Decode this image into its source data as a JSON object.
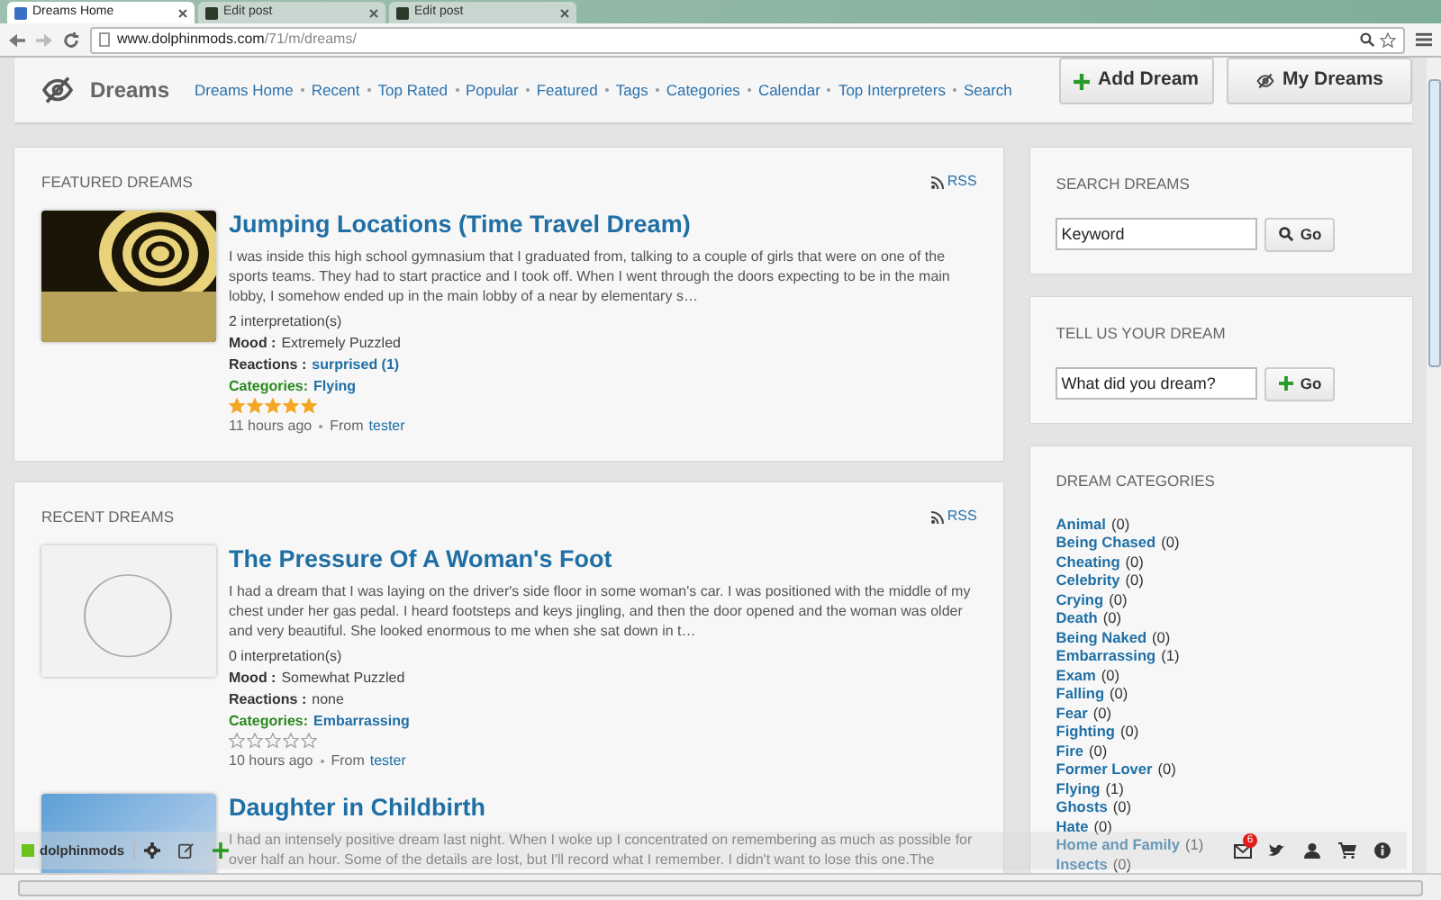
{
  "browser": {
    "tabs": [
      {
        "label": "Dreams Home",
        "selected": true
      },
      {
        "label": "Edit post",
        "selected": false
      },
      {
        "label": "Edit post",
        "selected": false
      }
    ],
    "address": {
      "host": "www.dolphinmods.com",
      "path": "/71/m/dreams/"
    }
  },
  "header": {
    "title": "Dreams",
    "nav": [
      "Dreams Home",
      "Recent",
      "Top Rated",
      "Popular",
      "Featured",
      "Tags",
      "Categories",
      "Calendar",
      "Top Interpreters",
      "Search"
    ],
    "buttons": [
      {
        "kind": "add",
        "label": "Add Dream"
      },
      {
        "kind": "mine",
        "label": "My Dreams"
      }
    ]
  },
  "sections": [
    {
      "title": "FEATURED DREAMS",
      "rss": "RSS",
      "dreams": [
        {
          "title": "Jumping Locations (Time Travel Dream)",
          "kind": "tunnel",
          "description": "I was inside this high school gymnasium that I graduated from, talking to a couple of girls that were on one of the sports teams. They had to start practice and I took off. When I went through the doors expecting to be in the main lobby, I somehow ended up in the main lobby of a near by elementary s…",
          "interpretations": "2 interpretation(s)",
          "mood_label": "Mood :",
          "mood": "Extremely Puzzled",
          "reactions_label": "Reactions :",
          "reactions": "surprised (1)",
          "reactions_link": true,
          "categories_label": "Categories:",
          "categories": "Flying",
          "stars": 5,
          "time": "11 hours ago",
          "from_label": "From",
          "author": "tester"
        }
      ]
    },
    {
      "title": "RECENT DREAMS",
      "rss": "RSS",
      "dreams": [
        {
          "title": "The Pressure Of A Woman's Foot",
          "kind": "face",
          "description": "I had a dream that I was laying on the driver's side floor in some woman's car. I was positioned with the middle of my chest under her gas pedal. I heard footsteps and keys jingling, and then the door opened and the woman was older and very beautiful. She looked enormous to me when she sat down in t…",
          "interpretations": "0 interpretation(s)",
          "mood_label": "Mood :",
          "mood": "Somewhat Puzzled",
          "reactions_label": "Reactions :",
          "reactions": "none",
          "reactions_link": false,
          "categories_label": "Categories:",
          "categories": "Embarrassing",
          "stars": 0,
          "time": "10 hours ago",
          "from_label": "From",
          "author": "tester"
        },
        {
          "title": "Daughter in Childbirth",
          "kind": "hospital",
          "description": "I had an intensely positive dream last night. When I woke up I concentrated on remembering as much as possible for over half an hour. Some of the details are lost, but I'll record what I remember. I didn't want to lose this one.The"
        }
      ]
    }
  ],
  "sidebar": {
    "search": {
      "title": "SEARCH DREAMS",
      "placeholder": "Keyword",
      "button": "Go"
    },
    "tell": {
      "title": "TELL US YOUR DREAM",
      "placeholder": "What did you dream?",
      "button": "Go"
    },
    "categories": {
      "title": "DREAM CATEGORIES",
      "items": [
        {
          "name": "Animal",
          "count": "(0)"
        },
        {
          "name": "Being Chased",
          "count": "(0)"
        },
        {
          "name": "Cheating",
          "count": "(0)"
        },
        {
          "name": "Celebrity",
          "count": "(0)"
        },
        {
          "name": "Crying",
          "count": "(0)"
        },
        {
          "name": "Death",
          "count": "(0)"
        },
        {
          "name": "Being Naked",
          "count": "(0)"
        },
        {
          "name": "Embarrassing",
          "count": "(1)"
        },
        {
          "name": "Exam",
          "count": "(0)"
        },
        {
          "name": "Falling",
          "count": "(0)"
        },
        {
          "name": "Fear",
          "count": "(0)"
        },
        {
          "name": "Fighting",
          "count": "(0)"
        },
        {
          "name": "Fire",
          "count": "(0)"
        },
        {
          "name": "Former Lover",
          "count": "(0)"
        },
        {
          "name": "Flying",
          "count": "(1)"
        },
        {
          "name": "Ghosts",
          "count": "(0)"
        },
        {
          "name": "Hate",
          "count": "(0)"
        },
        {
          "name": "Home and Family",
          "count": "(1)"
        },
        {
          "name": "Insects",
          "count": "(0)"
        }
      ]
    }
  },
  "toolbar": {
    "user": "dolphinmods",
    "mail_badge": "6"
  }
}
